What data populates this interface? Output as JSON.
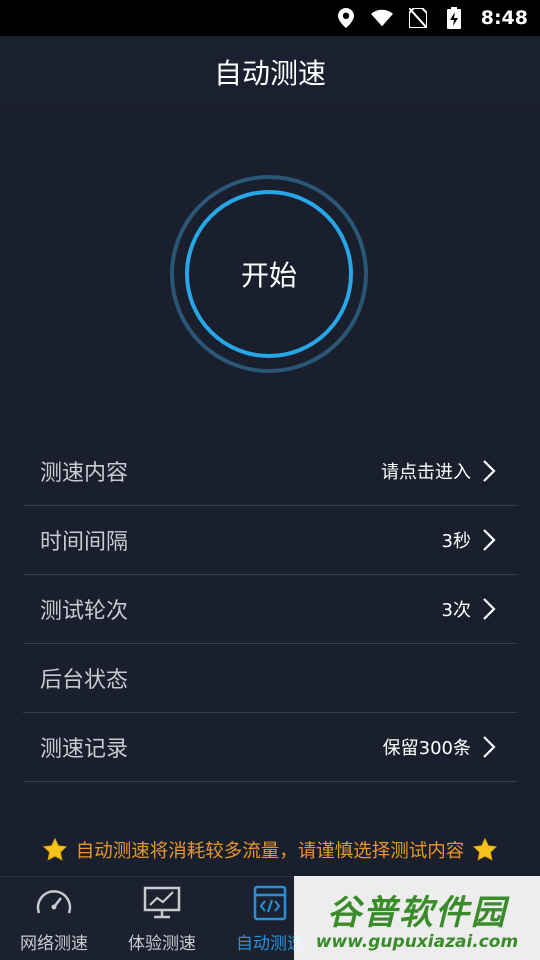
{
  "status_bar": {
    "time": "8:48",
    "icons": [
      "location-icon",
      "wifi-icon",
      "no-sim-icon",
      "battery-charging-icon"
    ]
  },
  "header": {
    "title": "自动测速"
  },
  "start_button": {
    "label": "开始"
  },
  "settings": {
    "rows": [
      {
        "label": "测速内容",
        "value": "请点击进入",
        "has_chevron": true
      },
      {
        "label": "时间间隔",
        "value": "3秒",
        "has_chevron": true
      },
      {
        "label": "测试轮次",
        "value": "3次",
        "has_chevron": true
      },
      {
        "label": "后台状态",
        "value": "",
        "has_chevron": false
      },
      {
        "label": "测速记录",
        "value": "保留300条",
        "has_chevron": true
      }
    ]
  },
  "notice": {
    "text": "自动测速将消耗较多流量，请谨慎选择测试内容",
    "icon": "star-icon"
  },
  "bottom_nav": {
    "items": [
      {
        "label": "网络测速",
        "icon": "speedometer-icon",
        "active": false
      },
      {
        "label": "体验测速",
        "icon": "monitor-chart-icon",
        "active": false
      },
      {
        "label": "自动测速",
        "icon": "code-window-icon",
        "active": true
      }
    ]
  },
  "watermark": {
    "title": "谷普软件园",
    "url": "www.gupuxiazai.com"
  },
  "colors": {
    "background": "#1a1f2e",
    "accent": "#27a7e7",
    "notice": "#e6962b",
    "active_nav": "#2a8fd6"
  }
}
